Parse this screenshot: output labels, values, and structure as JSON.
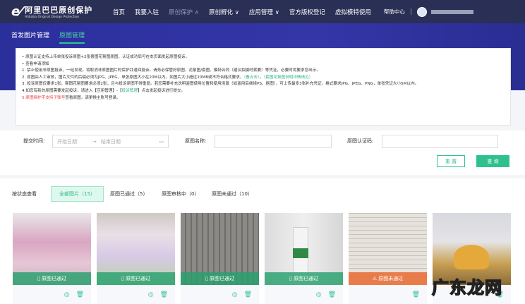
{
  "header": {
    "logo_title": "阿里巴巴原创保护",
    "logo_subtitle": "Alibaba Original Design Protection",
    "nav": [
      {
        "label": "首页"
      },
      {
        "label": "我要入驻"
      },
      {
        "label": "原创保护 ∧"
      },
      {
        "label": "原创孵化 ∨"
      },
      {
        "label": "应用管理 ∨"
      },
      {
        "label": "官方版权登记"
      },
      {
        "label": "虚拟模特使用"
      }
    ],
    "help": "帮助中心"
  },
  "subnav": {
    "tabs": [
      {
        "label": "首发图片管理"
      },
      {
        "label": "原图管理"
      }
    ]
  },
  "notice": {
    "line1": "• 原图认证支持上传单张投诉原图+2张套图花絮图原图，认证成功后可在本页面发起原图投诉。",
    "line2": "• 查看申请须知",
    "line3": "1. 禁止使用非原图投诉，一经发现，将取消非原图图片的保护并退回投诉。请务必保管好原图、花絮图/套图、模特合同（建议拍摄时索要）等凭证，必要时将要求您出示。",
    "line4a": "2. 原图由人工审核，图片文件的后缀必须为JPG、JPEG，单张原图大小在20M以内，如图片大小超过20MB或不符合格式要求，",
    "line4_link1": "（看点击）",
    "line4_sep": "，",
    "line4_link2": "（套图花絮图说明详情请见）",
    "line5": "3. 投诉原图仅要求1张，套图花絮图要求必须2张，且与投诉原图不得重复。若您需要补充说明盗图使用位置和使用场景（如盗用后继续PS、抠图），可上传最多3张补充凭证，格式要求JPG、JPEG、PNG，单张凭证大小5M以内。",
    "line6a": "4.如您有新的原图需要发起投诉，请进入【应用管理】-【",
    "line6_link": "投诉管理",
    "line6b": "】点击发起投诉进行提交。",
    "line7_num": "5.",
    "line7_red": "原图保护不支持子账号",
    "line7b": "查看原图，请更换主账号登录。"
  },
  "filter": {
    "time_label": "提交时间:",
    "start_placeholder": "开始日期",
    "arrow": "→",
    "end_placeholder": "结束日期",
    "name_label": "原图名称:",
    "code_label": "原图认证码:",
    "reset": "重 置",
    "search": "查 询"
  },
  "status_tabs": {
    "label": "按状态查看",
    "tabs": [
      {
        "label": "全部图片（15）"
      },
      {
        "label": "原图已通过（5）"
      },
      {
        "label": "原图审核中（0）"
      },
      {
        "label": "原图未通过（10）"
      }
    ]
  },
  "cards": [
    {
      "status": "原图已通过",
      "state": "passed"
    },
    {
      "status": "原图已通过",
      "state": "passed"
    },
    {
      "status": "原图已通过",
      "state": "passed"
    },
    {
      "status": "原图已通过",
      "state": "passed"
    },
    {
      "status": "原图未通过",
      "state": "failed"
    },
    {
      "status": "",
      "state": "none"
    }
  ],
  "watermark": "广东龙网",
  "colors": {
    "accent": "#35c197",
    "passed": "#2fa67a",
    "failed": "#e8743e",
    "nav_bg": "#2a2f55"
  }
}
